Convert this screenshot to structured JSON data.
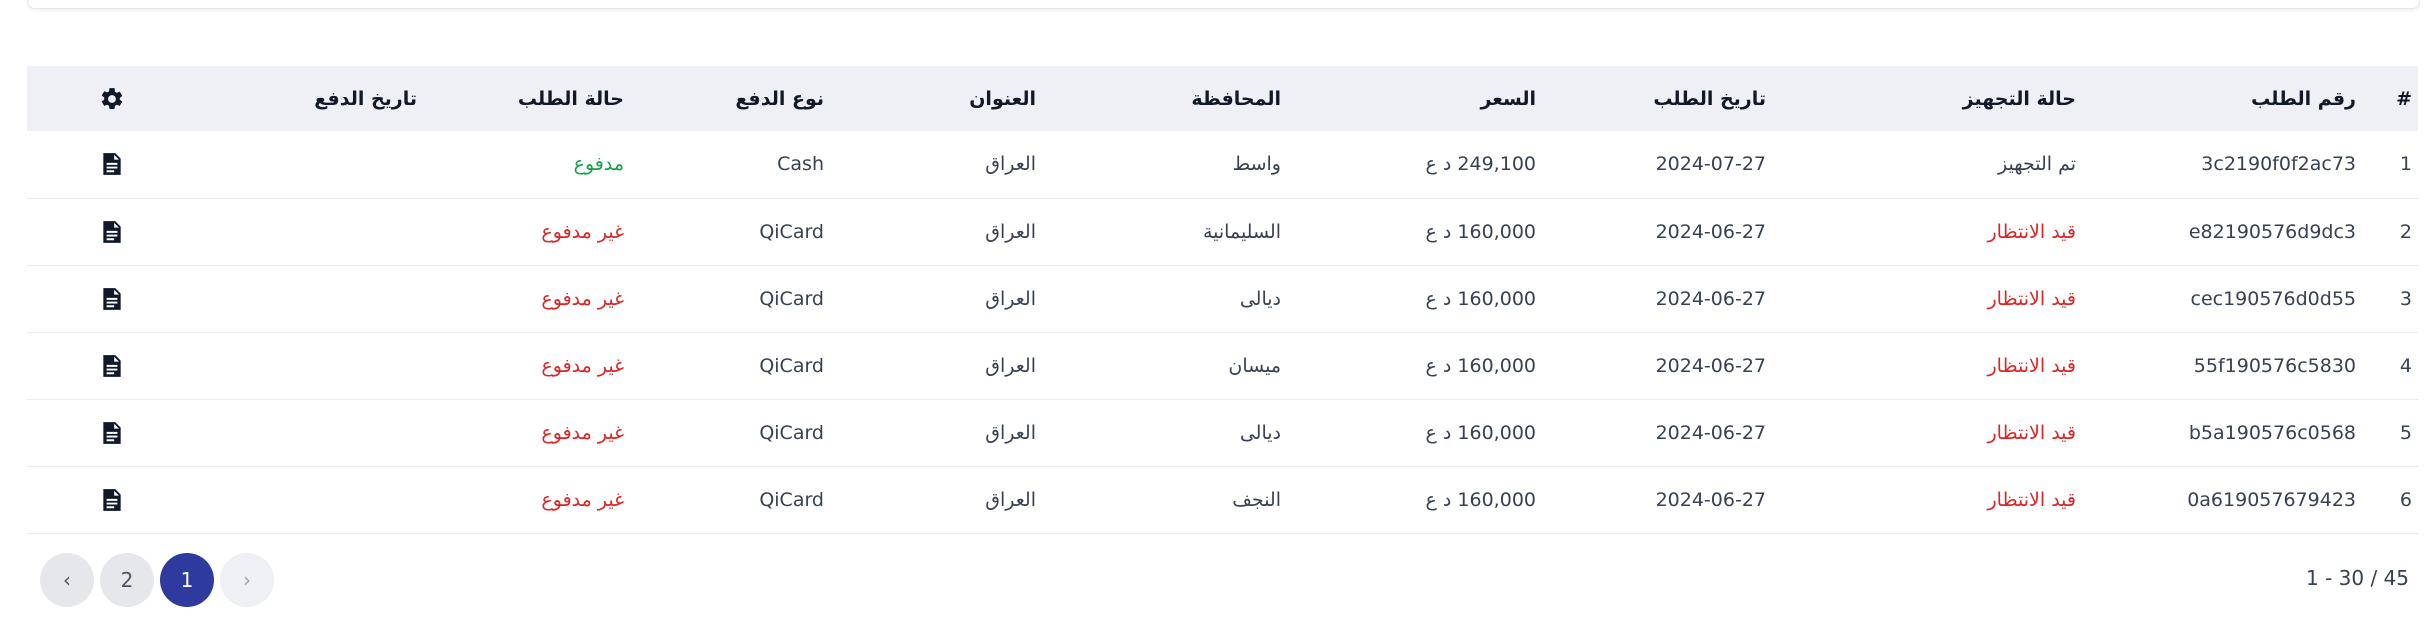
{
  "table": {
    "headers": {
      "index": "#",
      "order_id": "رقم الطلب",
      "prep_status": "حالة التجهيز",
      "order_date": "تاريخ الطلب",
      "price": "السعر",
      "governorate": "المحافظة",
      "address": "العنوان",
      "payment_type": "نوع الدفع",
      "order_status": "حالة الطلب",
      "payment_date": "تاريخ الدفع",
      "settings_icon": "gear-icon"
    },
    "rows": [
      {
        "index": "1",
        "order_id": "3c2190f0f2ac73",
        "prep_status": "تم التجهيز",
        "order_date": "2024-07-27",
        "price": "249,100 د ع",
        "governorate": "واسط",
        "address": "العراق",
        "payment_type": "Cash",
        "order_status": "مدفوع",
        "payment_date": ""
      },
      {
        "index": "2",
        "order_id": "e82190576d9dc3",
        "prep_status": "قيد الانتظار",
        "order_date": "2024-06-27",
        "price": "160,000 د ع",
        "governorate": "السليمانية",
        "address": "العراق",
        "payment_type": "QiCard",
        "order_status": "غير مدفوع",
        "payment_date": ""
      },
      {
        "index": "3",
        "order_id": "cec190576d0d55",
        "prep_status": "قيد الانتظار",
        "order_date": "2024-06-27",
        "price": "160,000 د ع",
        "governorate": "ديالى",
        "address": "العراق",
        "payment_type": "QiCard",
        "order_status": "غير مدفوع",
        "payment_date": ""
      },
      {
        "index": "4",
        "order_id": "55f190576c5830",
        "prep_status": "قيد الانتظار",
        "order_date": "2024-06-27",
        "price": "160,000 د ع",
        "governorate": "ميسان",
        "address": "العراق",
        "payment_type": "QiCard",
        "order_status": "غير مدفوع",
        "payment_date": ""
      },
      {
        "index": "5",
        "order_id": "b5a190576c0568",
        "prep_status": "قيد الانتظار",
        "order_date": "2024-06-27",
        "price": "160,000 د ع",
        "governorate": "ديالى",
        "address": "العراق",
        "payment_type": "QiCard",
        "order_status": "غير مدفوع",
        "payment_date": ""
      },
      {
        "index": "6",
        "order_id": "0a619057679423",
        "prep_status": "قيد الانتظار",
        "order_date": "2024-06-27",
        "price": "160,000 د ع",
        "governorate": "النجف",
        "address": "العراق",
        "payment_type": "QiCard",
        "order_status": "غير مدفوع",
        "payment_date": ""
      }
    ],
    "row_action_icon": "document-icon"
  },
  "pagination": {
    "prev_label": "‹",
    "next_label": "›",
    "pages": [
      "1",
      "2"
    ],
    "current_page": "1",
    "range_text": "1 - 30 / 45"
  },
  "colors": {
    "accent": "#2f3a9e",
    "paid": "#16a34a",
    "unpaid": "#dc2626",
    "header_bg": "#eef0f5"
  }
}
